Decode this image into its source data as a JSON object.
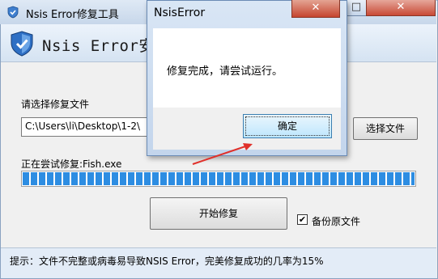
{
  "main_window": {
    "title": "Nsis Error修复工具",
    "minimize_glyph": "—",
    "maximize_glyph": "□",
    "close_glyph": "✕",
    "header_title": "Nsis Error安装",
    "file_label": "请选择修复文件",
    "file_path": "C:\\Users\\li\\Desktop\\1-2\\",
    "select_file_button": "选择文件",
    "repair_status": "正在尝试修复:Fish.exe",
    "progress_fraction": 1.0,
    "start_button": "开始修复",
    "backup_checkbox_label": "备份原文件",
    "backup_checked": true,
    "footer_tip": "提示：文件不完整或病毒易导致NSIS Error，完美修复成功的几率为15%"
  },
  "dialog": {
    "title": "NsisError",
    "close_glyph": "✕",
    "message": "修复完成，请尝试运行。",
    "ok_button": "确定"
  },
  "icons": {
    "app_icon": "shield-icon",
    "header_logo": "shield-icon",
    "check": "checkmark-icon",
    "annotation": "red-arrow"
  },
  "colors": {
    "progress": "#2d8de2",
    "close_button": "#c84a36",
    "annotation_arrow": "#e0302a"
  }
}
